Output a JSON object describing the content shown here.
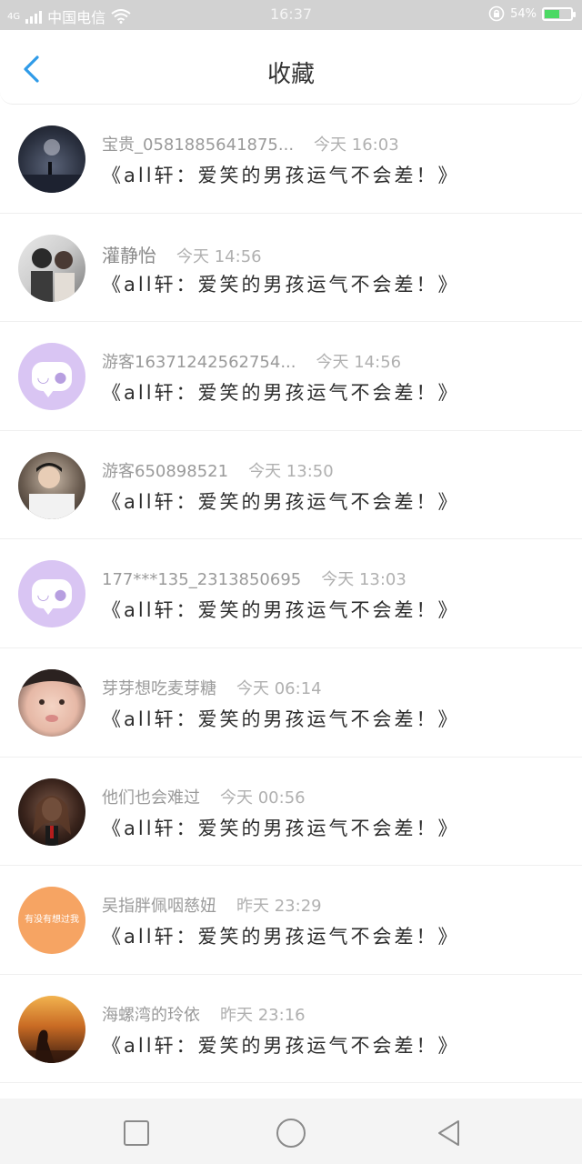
{
  "status_bar": {
    "network": "4G",
    "carrier": "中国电信",
    "time": "16:37",
    "battery": "54%",
    "battery_level": 0.54
  },
  "header": {
    "title": "收藏",
    "back_icon": "chevron-left-icon"
  },
  "favorites": [
    {
      "name": "宝贵_0581885641875...",
      "time": "今天 16:03",
      "message": "《all轩：爱笑的男孩运气不会差！》",
      "avatar": "night-scene-photo"
    },
    {
      "name": "灌静怡",
      "time": "今天 14:56",
      "message": "《all轩：爱笑的男孩运气不会差！》",
      "avatar": "couple-photo"
    },
    {
      "name": "游客16371242562754...",
      "time": "今天 14:56",
      "message": "《all轩：爱笑的男孩运气不会差！》",
      "avatar": "default-chat-avatar"
    },
    {
      "name": "游客650898521",
      "time": "今天 13:50",
      "message": "《all轩：爱笑的男孩运气不会差！》",
      "avatar": "boy-photo"
    },
    {
      "name": "177***135_2313850695",
      "time": "今天 13:03",
      "message": "《all轩：爱笑的男孩运气不会差！》",
      "avatar": "default-chat-avatar"
    },
    {
      "name": "芽芽想吃麦芽糖",
      "time": "今天 06:14",
      "message": "《all轩：爱笑的男孩运气不会差！》",
      "avatar": "face-photo"
    },
    {
      "name": "他们也会难过",
      "time": "今天 00:56",
      "message": "《all轩：爱笑的男孩运气不会差！》",
      "avatar": "girl-photo"
    },
    {
      "name": "吴指胖佩咽慈妞",
      "time": "昨天 23:29",
      "message": "《all轩：爱笑的男孩运气不会差！》",
      "avatar": "orange-text-avatar",
      "avatar_text": "有没有想过我"
    },
    {
      "name": "海螺湾的玲依",
      "time": "昨天 23:16",
      "message": "《all轩：爱笑的男孩运气不会差！》",
      "avatar": "sunset-photo"
    }
  ],
  "nav_bar": {
    "recent_icon": "square-icon",
    "home_icon": "circle-icon",
    "back_icon": "triangle-back-icon"
  },
  "colors": {
    "status_bar_bg": "#d2d2d2",
    "accent_blue": "#2f9be8",
    "name_gray": "#9a9a9a",
    "message_text": "#2d2d2d"
  }
}
